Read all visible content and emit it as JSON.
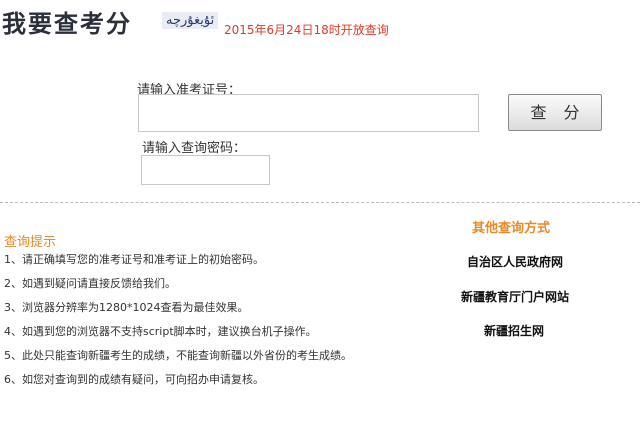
{
  "header": {
    "title": "我要查考分",
    "uyghur_text": "ئۇيغۇرچە",
    "open_notice": "2015年6月24日18时开放查询"
  },
  "form": {
    "ticket_label": "请输入准考证号：",
    "ticket_value": "",
    "password_label": "请输入查询密码：",
    "password_value": "",
    "query_button": "查 分"
  },
  "tips": {
    "title": "查询提示",
    "items": [
      "1、请正确填写您的准考证号和准考证上的初始密码。",
      "2、如遇到疑问请直接反馈给我们。",
      "3、浏览器分辨率为1280*1024查看为最佳效果。",
      "4、如遇到您的浏览器不支持script脚本时，建议换台机子操作。",
      "5、此处只能查询新疆考生的成绩，不能查询新疆以外省份的考生成绩。",
      "6、如您对查询到的成绩有疑问，可向招办申请复核。"
    ]
  },
  "other": {
    "title": "其他查询方式",
    "links": [
      "自治区人民政府网",
      "新疆教育厅门户网站",
      "新疆招生网"
    ]
  },
  "colors": {
    "accent_orange": "#e8892a",
    "notice_red": "#e23a2b"
  }
}
